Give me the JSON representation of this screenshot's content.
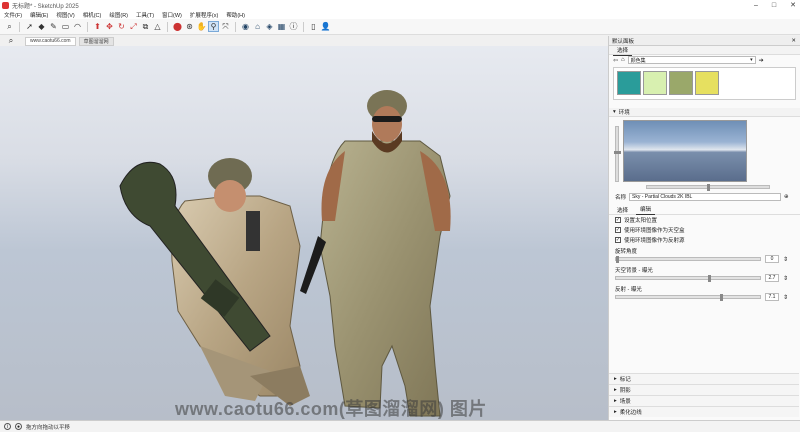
{
  "window": {
    "title": "无标题* - SketchUp 2025"
  },
  "menu": [
    "文件(F)",
    "编辑(E)",
    "视图(V)",
    "相机(C)",
    "绘图(R)",
    "工具(T)",
    "窗口(W)",
    "扩展程序(x)",
    "帮助(H)"
  ],
  "toolbar_icons": [
    "search-icon",
    "select-icon",
    "eraser-icon",
    "pencil-icon",
    "rectangle-icon",
    "arc-icon",
    "push-pull-icon",
    "move-icon",
    "rotate-icon",
    "scale-icon",
    "offset-icon",
    "tape-icon",
    "paint-icon",
    "orbit-icon",
    "pan-icon",
    "zoom-icon",
    "zoom-extents-icon",
    "geo-icon",
    "warehouse-icon",
    "extension-icon",
    "layout-icon",
    "model-info-icon",
    "profile-icon"
  ],
  "tabs": [
    {
      "label": "www.caotu66.com"
    },
    {
      "label": "草图溜溜网"
    }
  ],
  "tray": {
    "title": "默认面板",
    "materials": {
      "tab": "选择",
      "collection": "颜色集",
      "swatch_colors": [
        "#2a9c9a",
        "#d8f0b0",
        "#9aa86a",
        "#e6e060"
      ]
    },
    "environment": {
      "section": "环境",
      "name_label": "名称",
      "name_value": "Sky - Partial Clouds 2K IBL",
      "subtabs": [
        "选择",
        "编辑"
      ],
      "options": [
        {
          "label": "设置太阳位置",
          "checked": true
        },
        {
          "label": "使用环境图像作为天空盒",
          "checked": true
        },
        {
          "label": "使用环境图像作为反射源",
          "checked": true
        }
      ],
      "rotation": {
        "label": "旋转角度",
        "value": "0"
      },
      "sky_exposure": {
        "label": "天空背景 - 曝光",
        "value": "2.7"
      },
      "reflection_exposure": {
        "label": "反射 - 曝光",
        "value": "7.1"
      }
    },
    "collapsed_sections": [
      "标记",
      "阴影",
      "场景",
      "柔化边线"
    ]
  },
  "status": {
    "text": "拖方向拖动以平移"
  },
  "watermark": "www.caotu66.com(草图溜溜网) 图片"
}
